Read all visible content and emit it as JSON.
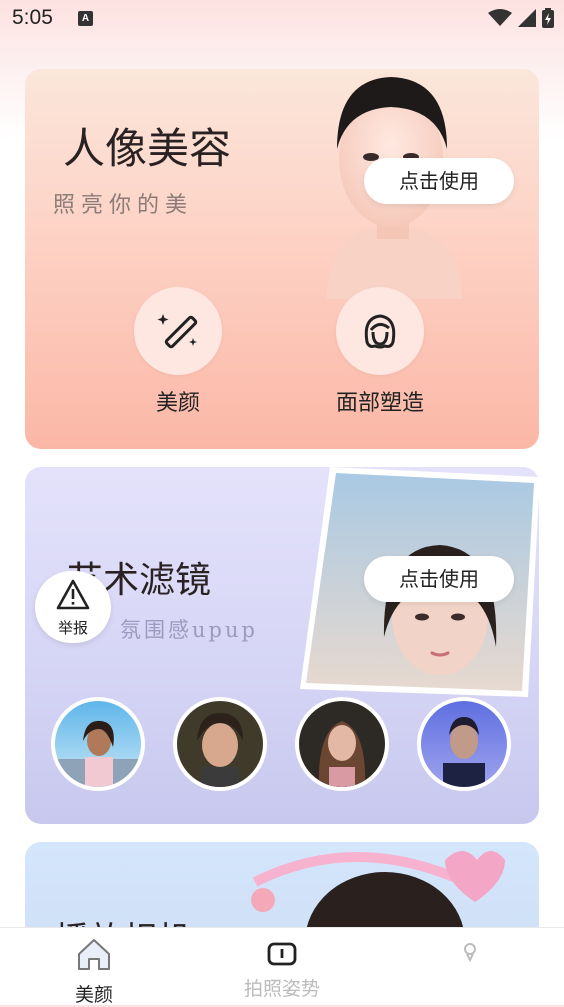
{
  "status_bar": {
    "time": "5:05",
    "app_icon_letter": "A",
    "icons": [
      "wifi-icon",
      "signal-icon",
      "battery-icon"
    ]
  },
  "card_portrait": {
    "title": "人像美容",
    "subtitle": "照亮你的美",
    "use_button": "点击使用",
    "features": [
      {
        "label": "美颜",
        "icon": "magic-wand-icon"
      },
      {
        "label": "面部塑造",
        "icon": "face-outline-icon"
      }
    ],
    "accent": "#fbb7a6"
  },
  "card_filter": {
    "title": "艺术滤镜",
    "subtitle": "氛围感upup",
    "use_button": "点击使用",
    "accent": "#c8c8ef"
  },
  "card_third": {
    "title": "播放相机"
  },
  "report_button": {
    "label": "举报",
    "icon": "warning-icon"
  },
  "bottom_nav": {
    "tabs": [
      {
        "label": "美颜",
        "icon": "home-icon",
        "active": true
      },
      {
        "label": "拍照姿势",
        "icon": "pose-icon",
        "active": false
      },
      {
        "label": "",
        "icon": "profile-icon",
        "active": false
      }
    ],
    "active_color": "#222222",
    "inactive_color": "#bcbcbc"
  }
}
